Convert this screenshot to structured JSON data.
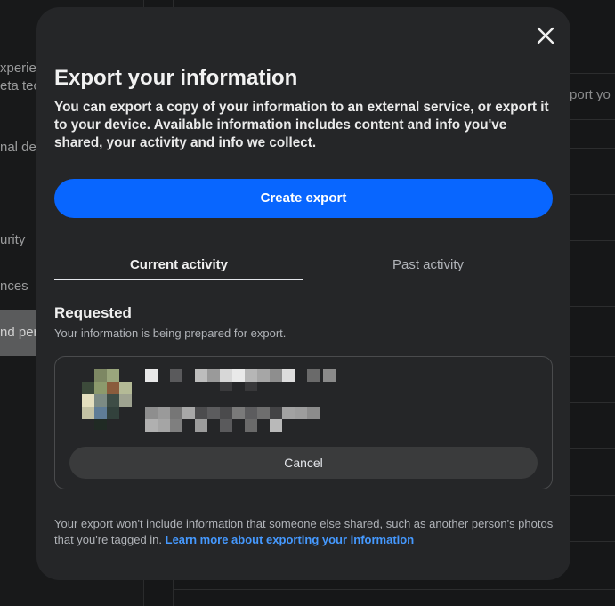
{
  "background": {
    "sidebar_items": [
      {
        "label": "Experiences",
        "display": "xperien"
      },
      {
        "label": "Meta technologies",
        "display": "eta tec"
      },
      {
        "label": "Personal details",
        "display": "nal det"
      },
      {
        "label": "Security",
        "display": "urity"
      },
      {
        "label": "Preferences",
        "display": "nces"
      },
      {
        "label": "Information and permissions",
        "display": "nd per"
      }
    ],
    "right_text": "port yo"
  },
  "modal": {
    "title": "Export your information",
    "description": "You can export a copy of your information to an external service, or export it to your device. Available information includes content and info you've shared, your activity and info we collect.",
    "create_button": "Create export",
    "tabs": [
      {
        "label": "Current activity",
        "selected": true
      },
      {
        "label": "Past activity",
        "selected": false
      }
    ],
    "requested": {
      "title": "Requested",
      "subtitle": "Your information is being prepared for export.",
      "cancel_button": "Cancel"
    },
    "footer": {
      "text": "Your export won't include information that someone else shared, such as another person's photos that you're tagged in.",
      "link": "Learn more about exporting your information"
    }
  },
  "colors": {
    "accent": "#0866ff",
    "link": "#4599ff",
    "modal_bg": "#252628"
  },
  "icons": {
    "close": "close-icon"
  }
}
